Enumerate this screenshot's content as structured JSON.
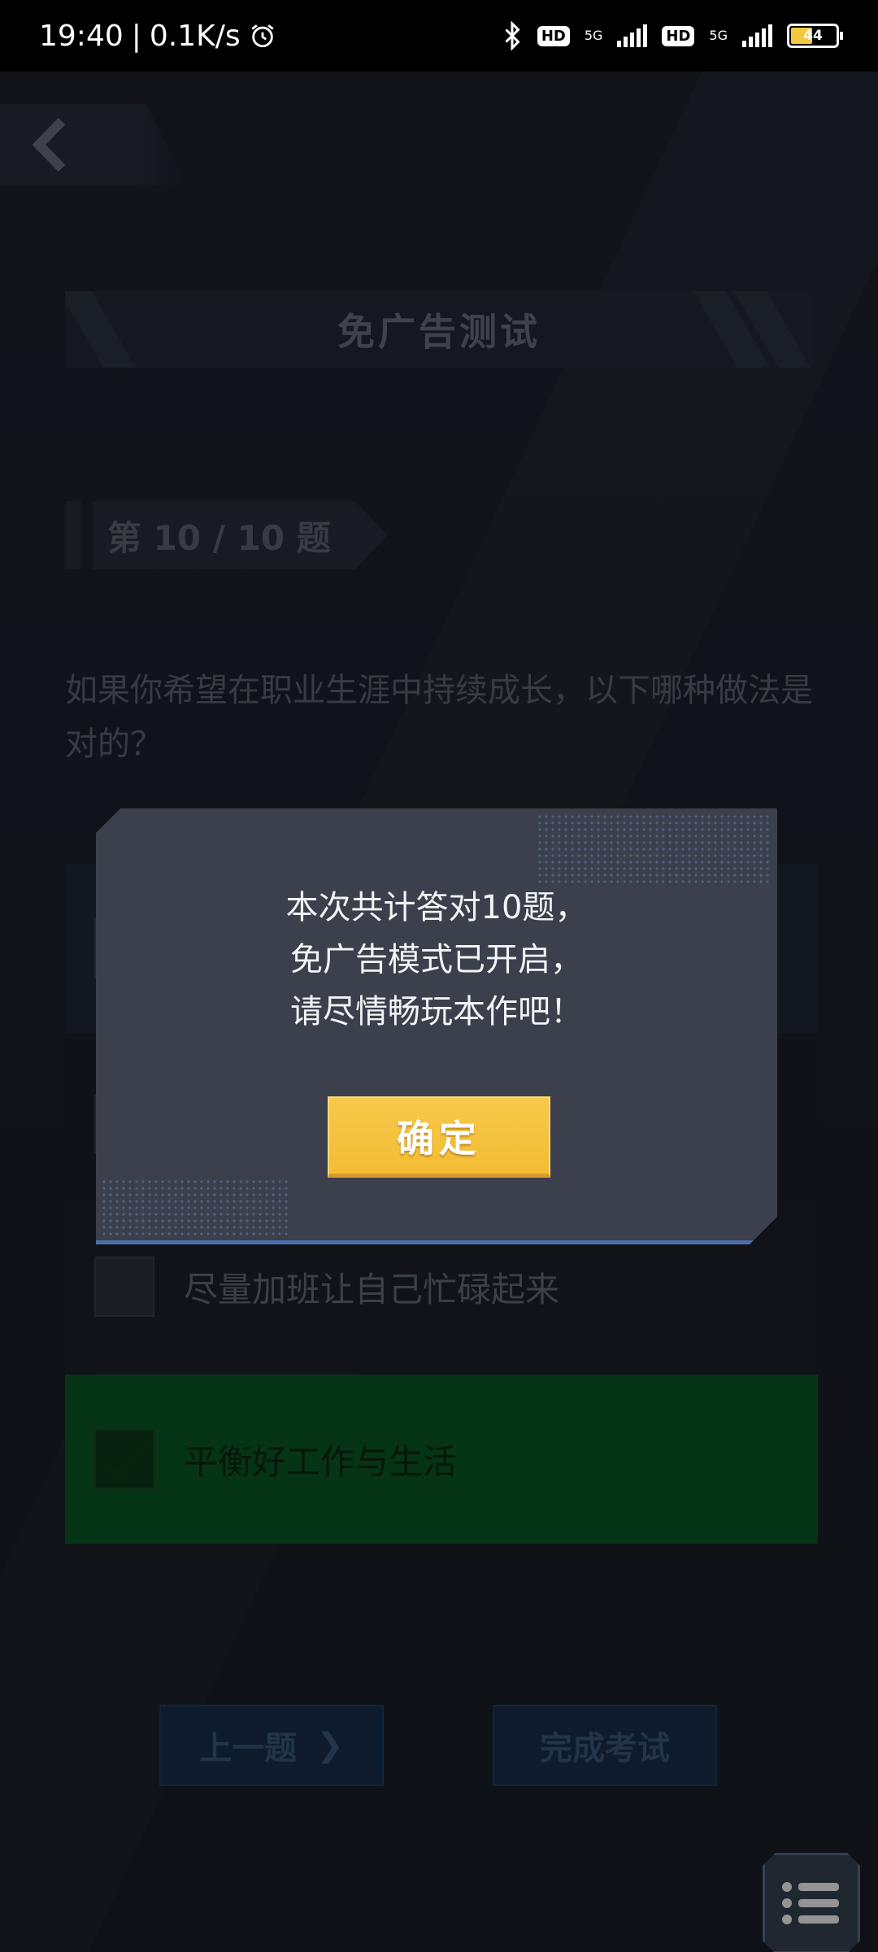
{
  "status_bar": {
    "time": "19:40",
    "separator": "|",
    "net_speed": "0.1K/s",
    "hd1": "HD",
    "net1": "5G",
    "hd2": "HD",
    "net2": "5G",
    "battery": "44"
  },
  "header": {
    "title": "免广告测试"
  },
  "quiz": {
    "index_label": "第 10 / 10 题",
    "question": "如果你希望在职业生涯中持续成长，以下哪种做法是对的？",
    "options": [
      {
        "label": "",
        "selected": false
      },
      {
        "label": "",
        "selected": false
      },
      {
        "label": "尽量加班让自己忙碌起来",
        "selected": false
      },
      {
        "label": "平衡好工作与生活",
        "selected": true
      }
    ]
  },
  "footer": {
    "prev_label": "上一题",
    "prev_arrow": "❯",
    "finish_label": "完成考试"
  },
  "dialog": {
    "line1": "本次共计答对10题，",
    "line2": "免广告模式已开启，",
    "line3": "请尽情畅玩本作吧！",
    "confirm_label": "确定"
  },
  "colors": {
    "background": "#1c2029",
    "dialog": "#3b404c",
    "confirm": "#f3bc33",
    "correct_option": "#0a5a28",
    "accent_border": "#4d6ea8"
  },
  "icons": [
    "back-chevron-icon",
    "alarm-icon",
    "bluetooth-icon",
    "signal-icon",
    "battery-icon",
    "check-icon",
    "menu-list-icon"
  ]
}
